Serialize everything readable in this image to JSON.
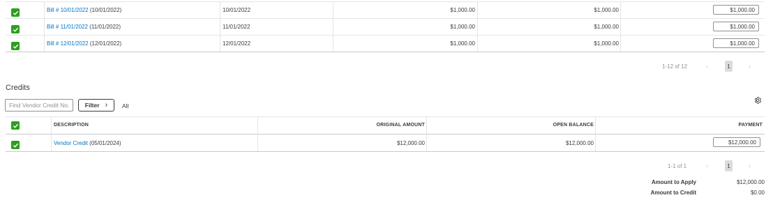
{
  "bills": {
    "rows": [
      {
        "checked": true,
        "bill_link": "Bill # 10/01/2022",
        "bill_date_suffix": "(10/01/2022)",
        "due_date": "10/01/2022",
        "original_amount": "$1,000.00",
        "open_balance": "$1,000.00",
        "payment": "$1,000.00"
      },
      {
        "checked": true,
        "bill_link": "Bill # 11/01/2022",
        "bill_date_suffix": "(11/01/2022)",
        "due_date": "11/01/2022",
        "original_amount": "$1,000.00",
        "open_balance": "$1,000.00",
        "payment": "$1,000.00"
      },
      {
        "checked": true,
        "bill_link": "Bill # 12/01/2022",
        "bill_date_suffix": "(12/01/2022)",
        "due_date": "12/01/2022",
        "original_amount": "$1,000.00",
        "open_balance": "$1,000.00",
        "payment": "$1,000.00"
      }
    ],
    "pagination": {
      "range": "1-12 of 12",
      "current_page": "1",
      "prev": "‹",
      "next": "›"
    }
  },
  "credits": {
    "title": "Credits",
    "search_placeholder": "Find Vendor Credit No.",
    "filter_label": "Filter",
    "filter_chevron": "›",
    "all_label": "All",
    "columns": {
      "description": "DESCRIPTION",
      "original_amount": "ORIGINAL AMOUNT",
      "open_balance": "OPEN BALANCE",
      "payment": "PAYMENT"
    },
    "rows": [
      {
        "checked": true,
        "description_link": "Vendor Credit",
        "description_suffix": "(05/01/2024)",
        "original_amount": "$12,000.00",
        "open_balance": "$12,000.00",
        "payment": "$12,000.00"
      }
    ],
    "pagination": {
      "range": "1-1 of 1",
      "current_page": "1",
      "prev": "‹",
      "next": "›"
    }
  },
  "summary": {
    "amount_to_apply_label": "Amount to Apply",
    "amount_to_apply_value": "$12,000.00",
    "amount_to_credit_label": "Amount to Credit",
    "amount_to_credit_value": "$0.00"
  },
  "icons": {
    "checkbox": "checkmark-icon",
    "settings": "gear-icon"
  },
  "colors": {
    "accent_green": "#2ca01c",
    "link_blue": "#0077c5"
  }
}
